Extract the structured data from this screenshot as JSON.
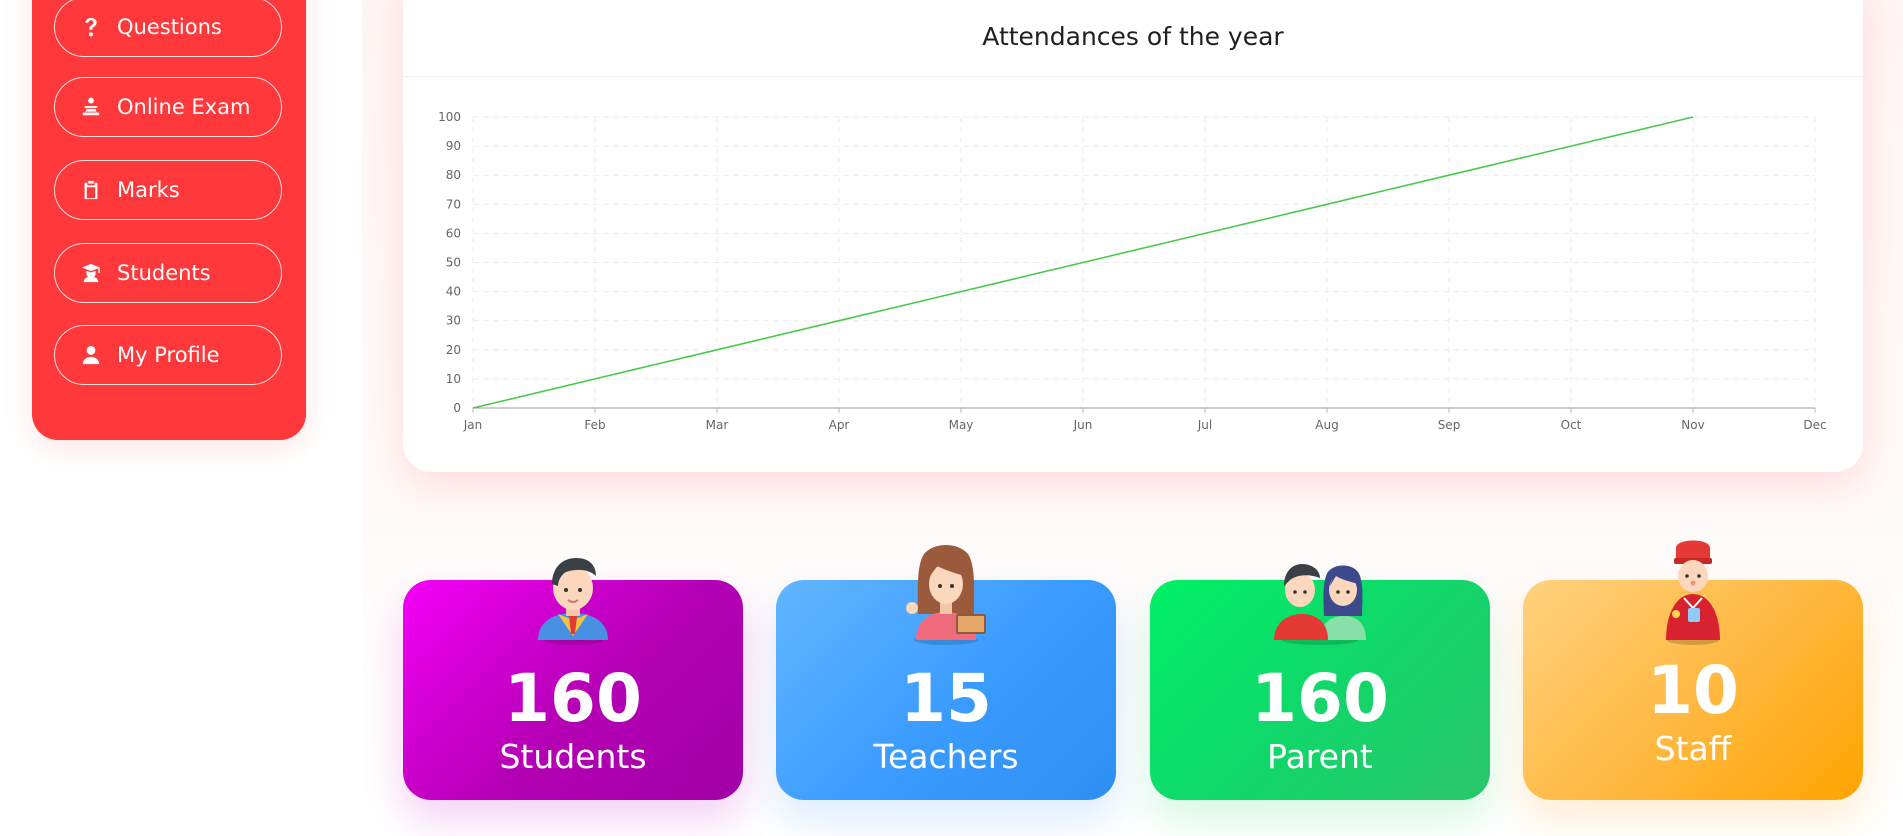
{
  "sidebar": {
    "items": [
      {
        "label": "Questions",
        "icon": "question-icon"
      },
      {
        "label": "Online Exam",
        "icon": "exam-icon"
      },
      {
        "label": "Marks",
        "icon": "clipboard-icon"
      },
      {
        "label": "Students",
        "icon": "graduate-icon"
      },
      {
        "label": "My Profile",
        "icon": "user-icon"
      }
    ]
  },
  "colors": {
    "sidebar": "#ff383b",
    "line": "#4cc84c",
    "students": "#c200c6",
    "teachers": "#3a9bff",
    "parent": "#12d56a",
    "staff": "#ffaa1a"
  },
  "chart_data": {
    "type": "line",
    "title": "Attendances of the year",
    "categories": [
      "Jan",
      "Feb",
      "Mar",
      "Apr",
      "May",
      "Jun",
      "Jul",
      "Aug",
      "Sep",
      "Oct",
      "Nov",
      "Dec"
    ],
    "series": [
      {
        "values": [
          0,
          10,
          20,
          30,
          40,
          50,
          60,
          70,
          80,
          90,
          100,
          null
        ]
      }
    ],
    "ylim": [
      0,
      100
    ],
    "yticks": [
      0,
      10,
      20,
      30,
      40,
      50,
      60,
      70,
      80,
      90,
      100
    ],
    "grid": true
  },
  "stats": [
    {
      "value": "160",
      "label": "Students",
      "avatar": "student-avatar"
    },
    {
      "value": "15",
      "label": "Teachers",
      "avatar": "teacher-avatar"
    },
    {
      "value": "160",
      "label": "Parent",
      "avatar": "parents-avatar"
    },
    {
      "value": "10",
      "label": "Staff",
      "avatar": "staff-avatar"
    }
  ]
}
